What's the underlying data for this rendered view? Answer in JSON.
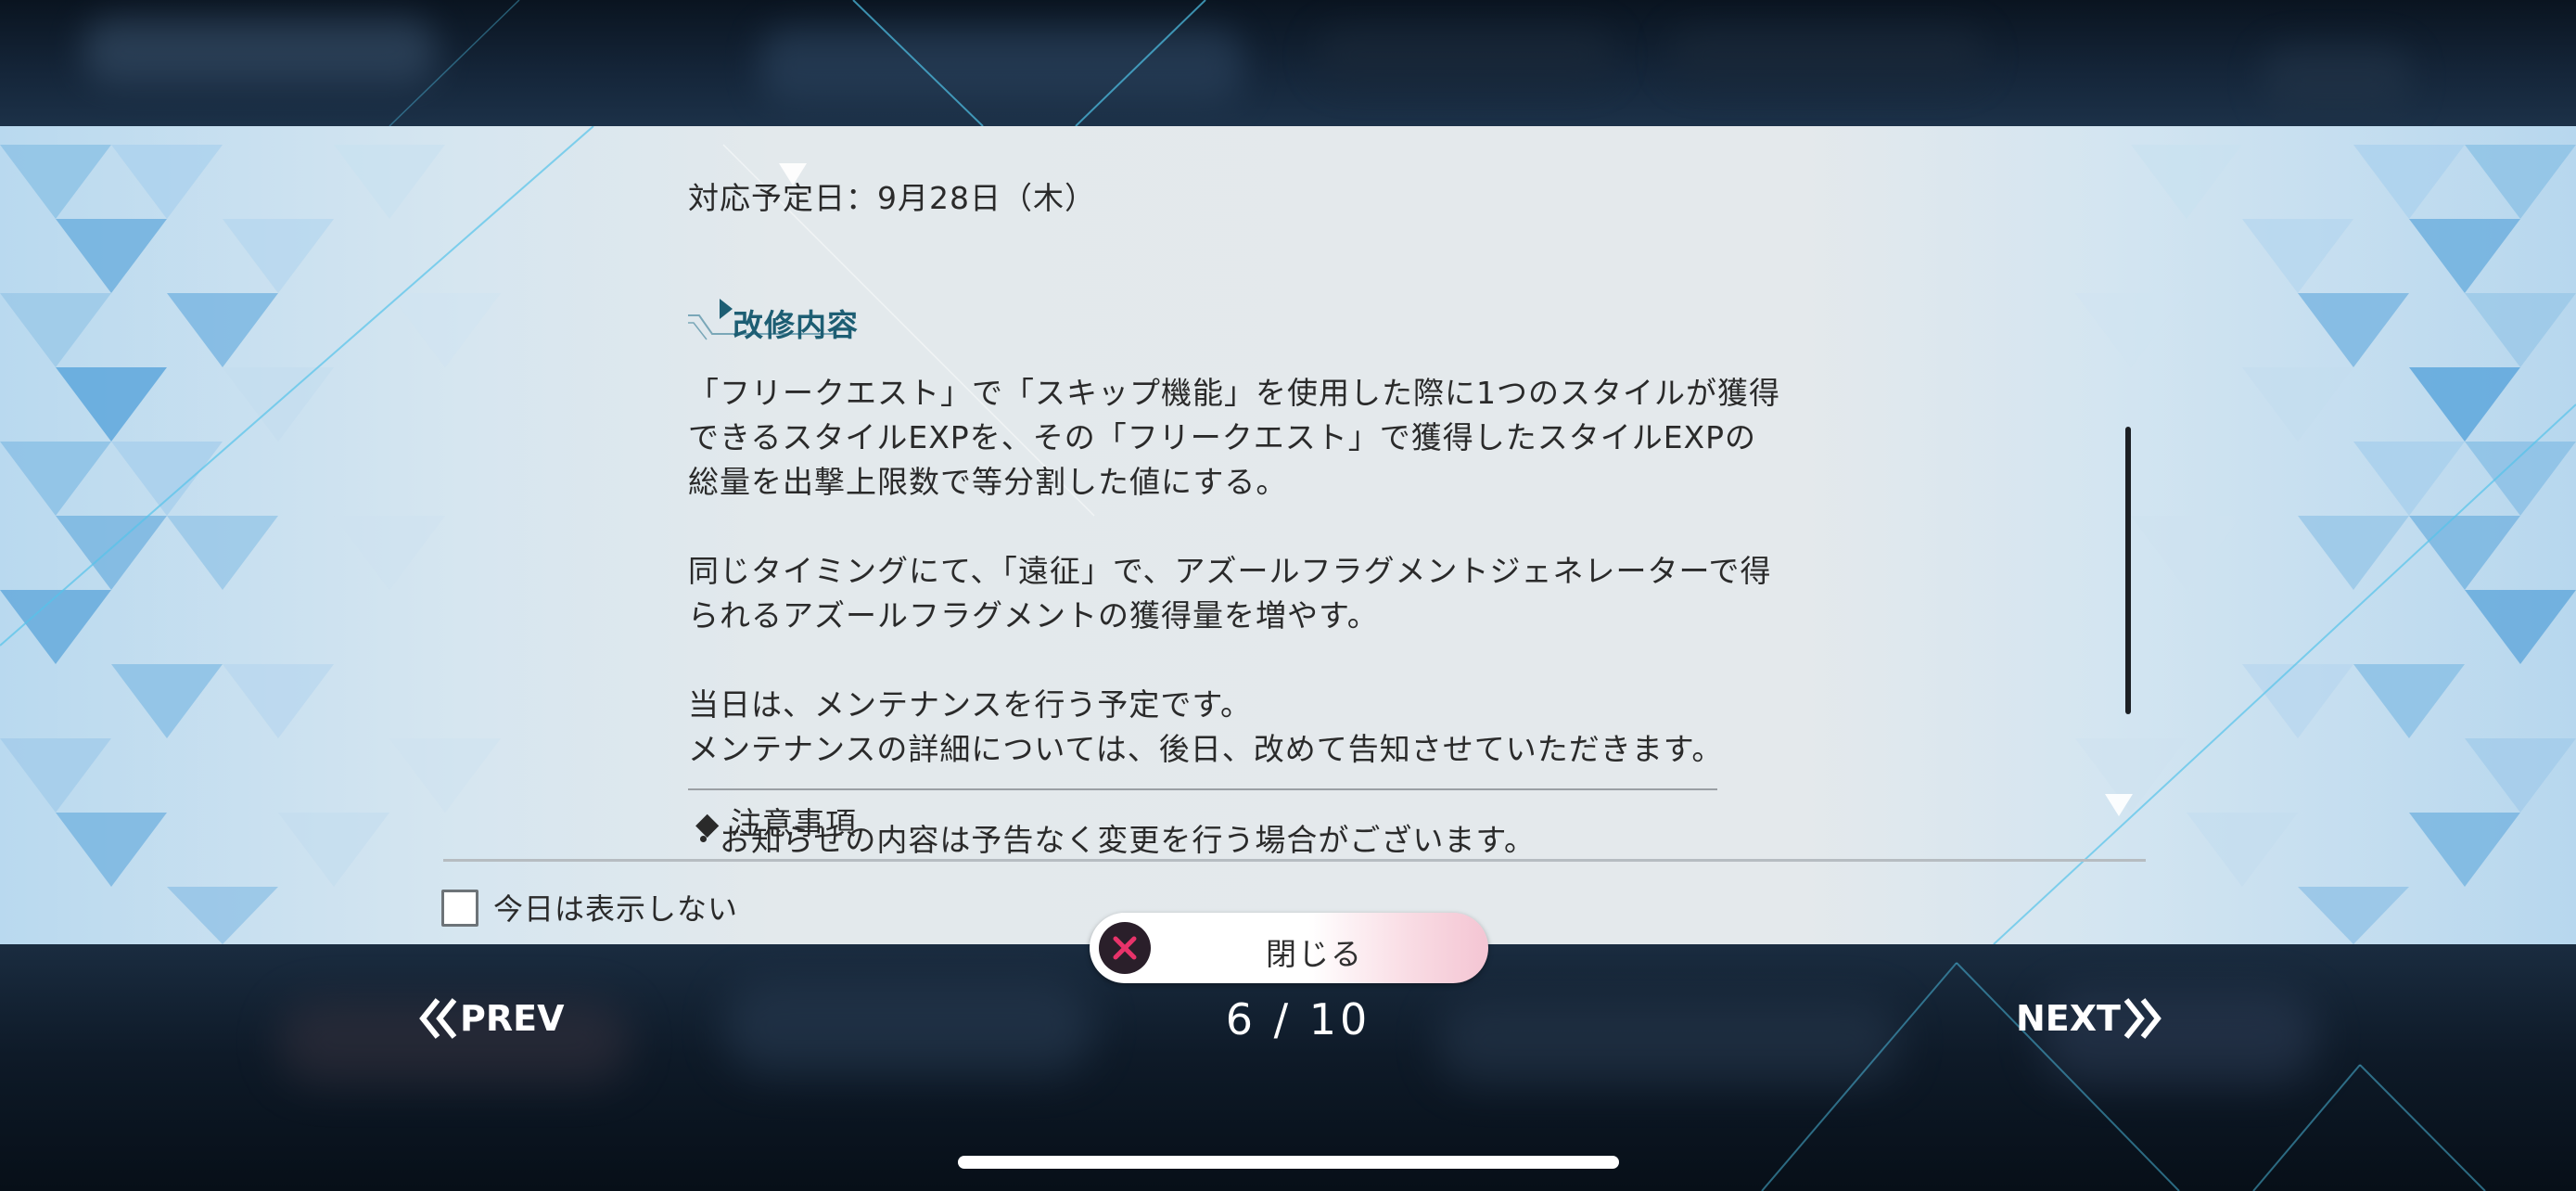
{
  "notice": {
    "scheduled_date": "対応予定日：9月28日（木）",
    "section_title": "改修内容",
    "body_lines": [
      "「フリークエスト」で「スキップ機能」を使用した際に1つのスタイルが獲得",
      "できるスタイルEXPを、その「フリークエスト」で獲得したスタイルEXPの",
      "総量を出撃上限数で等分割した値にする。",
      "",
      "同じタイミングにて、「遠征」で、アズールフラグメントジェネレーターで得",
      "られるアズールフラグメントの獲得量を増やす。",
      "",
      "当日は、メンテナンスを行う予定です。",
      "メンテナンスの詳細については、後日、改めて告知させていただきます。"
    ],
    "caution_heading": "◆ 注意事項",
    "caution_line": "・お知らせの内容は予告なく変更を行う場合がございます。"
  },
  "footer": {
    "dont_show_today_label": "今日は表示しない",
    "close_label": "閉じる",
    "prev_label": "PREV",
    "next_label": "NEXT",
    "page_indicator": "6 / 10"
  },
  "icons": {
    "close": "close-icon",
    "prev": "double-chevron-left-icon",
    "next": "double-chevron-right-icon",
    "section_marker": "triangle-right-icon"
  },
  "colors": {
    "section_title": "#1d5e73",
    "close_icon_x": "#e8336a"
  }
}
